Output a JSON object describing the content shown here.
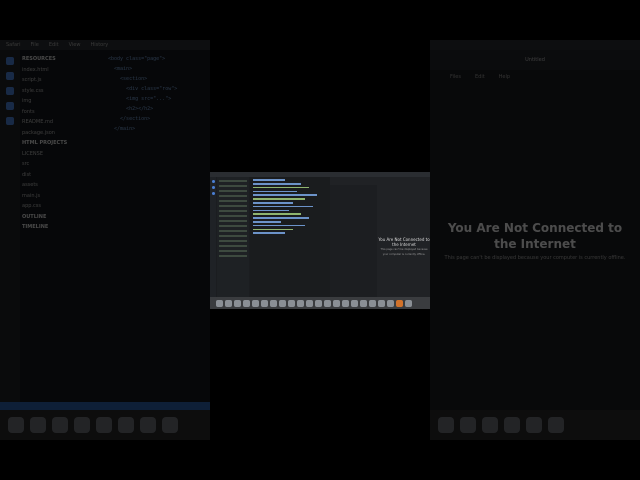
{
  "menu": [
    "Safari",
    "File",
    "Edit",
    "View",
    "History"
  ],
  "explorer": {
    "sections": [
      "RESOURCES",
      "HTML PROJECTS",
      "OUTLINE",
      "TIMELINE"
    ],
    "items": [
      "index.html",
      "script.js",
      "style.css",
      "img",
      "fonts",
      "README.md",
      "package.json",
      "LICENSE",
      "src",
      "dist",
      "assets",
      "main.js",
      "app.css"
    ]
  },
  "browser": {
    "tab_title": "Untitled",
    "tabs": [
      "Files",
      "Edit",
      "Help"
    ],
    "offline_title_line1": "You Are Not Connected to",
    "offline_title_line2": "the Internet",
    "offline_detail": "This page can't be displayed because your computer is currently offline."
  },
  "inner": {
    "offline_line1": "You Are Not Connected to",
    "offline_line2": "the Internet",
    "offline_detail": "This page can't be displayed because your computer is currently offline."
  },
  "colors": {
    "accent": "#2d5fa8",
    "dock_orange": "#d2722a"
  },
  "icons": [
    "explorer-icon",
    "search-icon",
    "git-icon",
    "debug-icon",
    "extensions-icon"
  ]
}
